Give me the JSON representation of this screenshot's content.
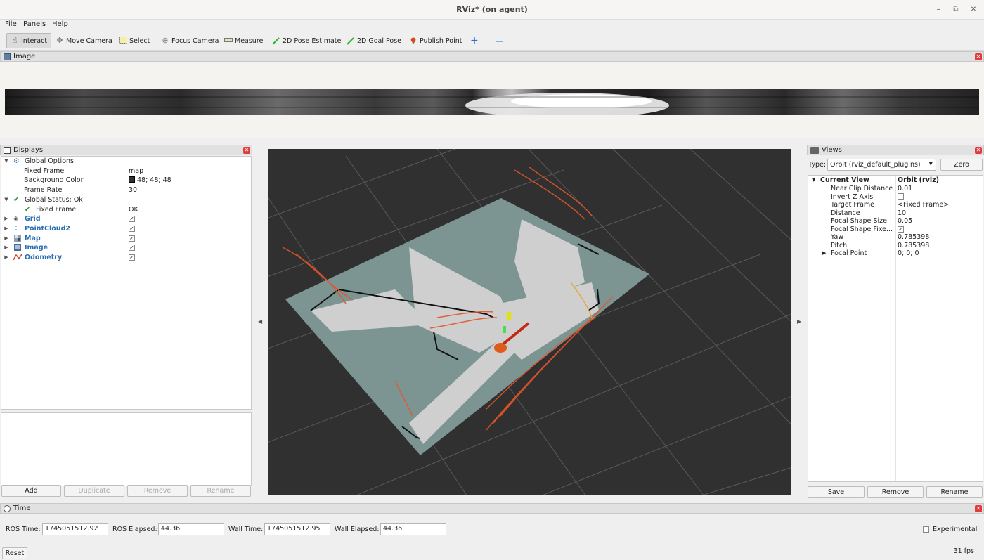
{
  "window": {
    "title": "RViz* (on agent)",
    "minimize": "–",
    "maximize": "⧉",
    "close": "✕"
  },
  "menu": [
    "File",
    "Panels",
    "Help"
  ],
  "toolbar": {
    "interact": "Interact",
    "move_camera": "Move Camera",
    "select": "Select",
    "focus_camera": "Focus Camera",
    "measure": "Measure",
    "pose_estimate": "2D Pose Estimate",
    "goal_pose": "2D Goal Pose",
    "publish_point": "Publish Point",
    "add_tool": "+",
    "remove_tool": "—"
  },
  "image_panel": {
    "title": "Image"
  },
  "displays": {
    "title": "Displays",
    "global_options": "Global Options",
    "fixed_frame_label": "Fixed Frame",
    "fixed_frame_value": "map",
    "bg_color_label": "Background Color",
    "bg_color_value": "48; 48; 48",
    "bg_color_hex": "#303030",
    "frame_rate_label": "Frame Rate",
    "frame_rate_value": "30",
    "global_status": "Global Status: Ok",
    "status_fixed_frame_label": "Fixed Frame",
    "status_fixed_frame_value": "OK",
    "items": [
      "Grid",
      "PointCloud2",
      "Map",
      "Image",
      "Odometry"
    ],
    "buttons": {
      "add": "Add",
      "duplicate": "Duplicate",
      "remove": "Remove",
      "rename": "Rename"
    }
  },
  "views": {
    "title": "Views",
    "type_label": "Type:",
    "type_value": "Orbit (rviz_default_plugins)",
    "zero": "Zero",
    "current_view": "Current View",
    "current_view_value": "Orbit (rviz)",
    "props": [
      {
        "label": "Near Clip Distance",
        "value": "0.01"
      },
      {
        "label": "Invert Z Axis",
        "value": ""
      },
      {
        "label": "Target Frame",
        "value": "<Fixed Frame>"
      },
      {
        "label": "Distance",
        "value": "10"
      },
      {
        "label": "Focal Shape Size",
        "value": "0.05"
      },
      {
        "label": "Focal Shape Fixe...",
        "value": ""
      },
      {
        "label": "Yaw",
        "value": "0.785398"
      },
      {
        "label": "Pitch",
        "value": "0.785398"
      },
      {
        "label": "Focal Point",
        "value": "0; 0; 0"
      }
    ],
    "buttons": {
      "save": "Save",
      "remove": "Remove",
      "rename": "Rename"
    }
  },
  "time": {
    "title": "Time",
    "ros_time_label": "ROS Time:",
    "ros_time": "1745051512.92",
    "ros_elapsed_label": "ROS Elapsed:",
    "ros_elapsed": "44.36",
    "wall_time_label": "Wall Time:",
    "wall_time": "1745051512.95",
    "wall_elapsed_label": "Wall Elapsed:",
    "wall_elapsed": "44.36",
    "experimental": "Experimental",
    "reset": "Reset",
    "fps": "31 fps"
  }
}
